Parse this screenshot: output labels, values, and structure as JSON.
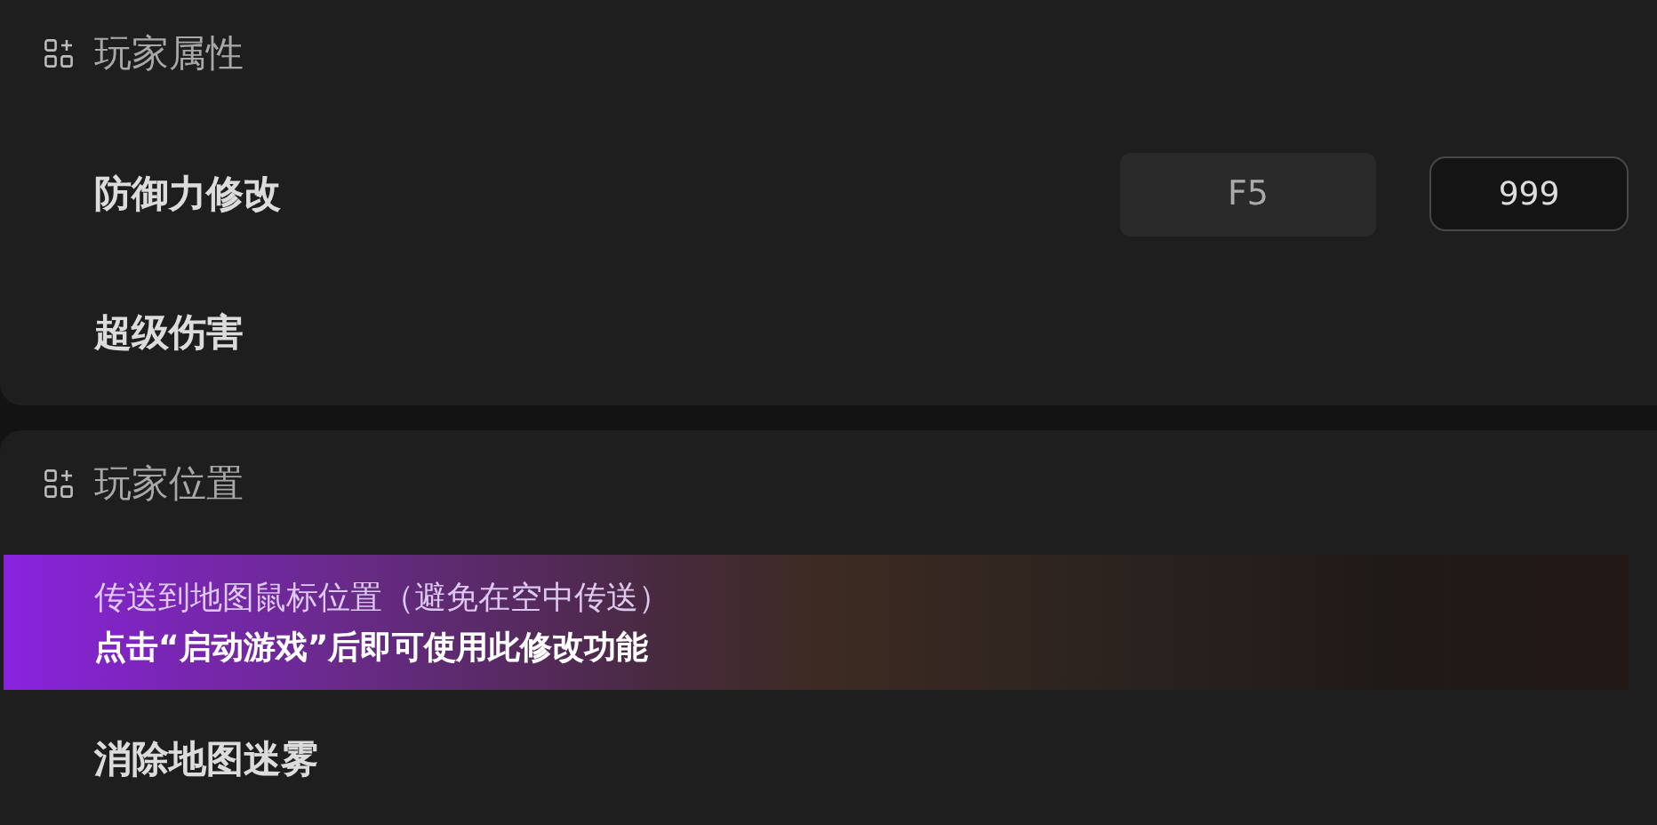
{
  "sections": [
    {
      "title": "玩家属性",
      "items": [
        {
          "label": "防御力修改",
          "selected": false,
          "hotkey": "F5",
          "value": "999"
        },
        {
          "label": "超级伤害",
          "selected": false
        }
      ]
    },
    {
      "title": "玩家位置",
      "items": [
        {
          "label": "传送到地图鼠标位置（避免在空中传送）",
          "selected": true,
          "hint": "点击“启动游戏”后即可使用此修改功能"
        },
        {
          "label": "消除地图迷雾",
          "selected": false
        }
      ]
    }
  ]
}
